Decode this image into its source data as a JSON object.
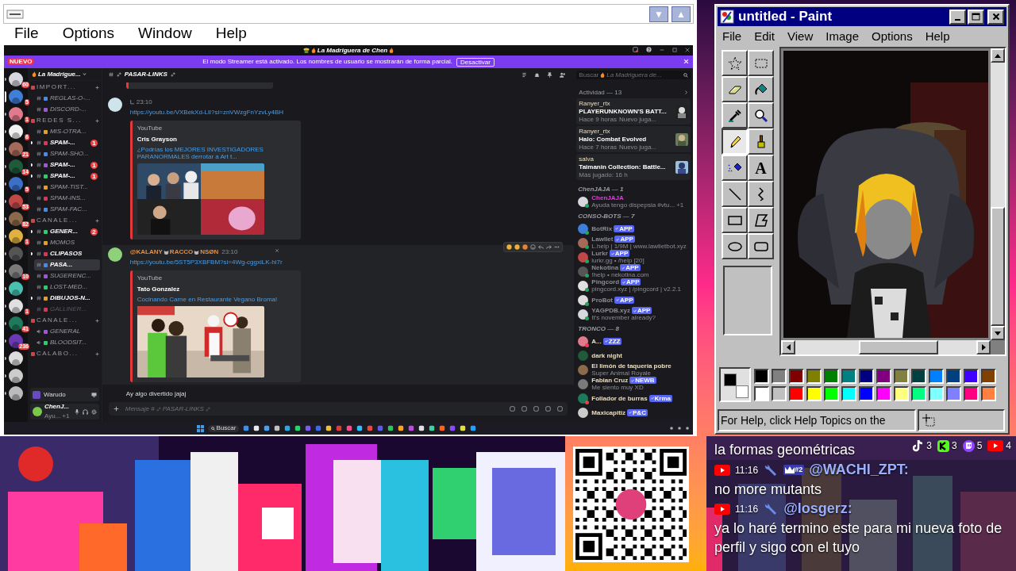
{
  "stream_window": {
    "menu": [
      "File",
      "Options",
      "Window",
      "Help"
    ],
    "title_buttons": [
      "▼",
      "▲"
    ]
  },
  "discord": {
    "title": "La Madriguera de Chen",
    "banner": {
      "new_badge": "NUEVO",
      "text": "El modo Streamer está activado. Los nombres de usuario se mostrarán de forma parcial.",
      "button": "Desactivar"
    },
    "servers": [
      {
        "badge": "60",
        "selected": false
      },
      {
        "badge": "5",
        "selected": true
      },
      {
        "badge": "1",
        "selected": false
      },
      {
        "badge": "6",
        "selected": false
      },
      {
        "badge": "21",
        "selected": false
      },
      {
        "badge": "14",
        "selected": false
      },
      {
        "badge": "5",
        "selected": false
      },
      {
        "badge": "53",
        "selected": false
      },
      {
        "badge": "82",
        "selected": false
      },
      {
        "badge": "1",
        "selected": false
      },
      {
        "selected": false
      },
      {
        "badge": "10",
        "selected": false
      },
      {
        "selected": false
      },
      {
        "badge": "1",
        "selected": false
      },
      {
        "badge": "41",
        "selected": false
      },
      {
        "badge": "236",
        "selected": false
      },
      {
        "selected": false
      },
      {
        "selected": false
      },
      {
        "selected": false
      }
    ],
    "server_name": "La Madrigue...",
    "channels": [
      {
        "kind": "category",
        "name": "IMPORT..."
      },
      {
        "kind": "text",
        "name": "REGLAS-O-...",
        "unread": false,
        "selected": false,
        "muted": false
      },
      {
        "kind": "text",
        "name": "DISCORD-...",
        "unread": false,
        "selected": false,
        "muted": false
      },
      {
        "kind": "category",
        "name": "REDES S..."
      },
      {
        "kind": "text",
        "name": "MIS-OTRA...",
        "unread": false,
        "selected": false,
        "muted": false
      },
      {
        "kind": "text",
        "name": "SPAM-...",
        "unread": true,
        "selected": false,
        "muted": false,
        "badge": "1"
      },
      {
        "kind": "text",
        "name": "SPAM-SHO...",
        "unread": false,
        "selected": false,
        "muted": false
      },
      {
        "kind": "text",
        "name": "SPAM-...",
        "unread": true,
        "selected": false,
        "muted": false,
        "badge": "1"
      },
      {
        "kind": "text",
        "name": "SPAM-...",
        "unread": true,
        "selected": false,
        "muted": false,
        "badge": "1"
      },
      {
        "kind": "text",
        "name": "SPAM-TIST...",
        "unread": false,
        "selected": false,
        "muted": false
      },
      {
        "kind": "text",
        "name": "SPAM-INS...",
        "unread": false,
        "selected": false,
        "muted": false
      },
      {
        "kind": "text",
        "name": "SPAM-FAC...",
        "unread": false,
        "selected": false,
        "muted": false
      },
      {
        "kind": "category",
        "name": "CANALE..."
      },
      {
        "kind": "text",
        "name": "GENER...",
        "unread": true,
        "selected": false,
        "muted": false,
        "badge": "2"
      },
      {
        "kind": "text",
        "name": "MOMOS",
        "unread": false,
        "selected": false,
        "muted": false
      },
      {
        "kind": "text",
        "name": "CLIPASOS",
        "unread": true,
        "selected": false,
        "muted": false
      },
      {
        "kind": "text",
        "name": "PASA...",
        "unread": false,
        "selected": true,
        "muted": false
      },
      {
        "kind": "text",
        "name": "SUGERENC...",
        "unread": false,
        "selected": false,
        "muted": false
      },
      {
        "kind": "text",
        "name": "LOST-MED...",
        "unread": false,
        "selected": false,
        "muted": false
      },
      {
        "kind": "text",
        "name": "DIBUJOS-N...",
        "unread": true,
        "selected": false,
        "muted": false
      },
      {
        "kind": "text",
        "name": "GALLINER...",
        "unread": false,
        "selected": false,
        "muted": true
      },
      {
        "kind": "category",
        "name": "CANALE..."
      },
      {
        "kind": "voice",
        "name": "GENERAL",
        "unread": false,
        "selected": false,
        "muted": false
      },
      {
        "kind": "voice",
        "name": "BLOODSIT...",
        "unread": false,
        "selected": false,
        "muted": false
      },
      {
        "kind": "category",
        "name": "CALABO..."
      }
    ],
    "warudo": "Warudo",
    "user": {
      "name": "ChenJ...",
      "status": "Ayu...",
      "extra": "+1"
    },
    "channel_title": "PASAR-LINKS",
    "messages": [
      {
        "kind": "embed",
        "time": "23:10",
        "link": "https://youtu.be/VXBekXd-LlI?si=znVWzgFnYzvLy4BH",
        "provider": "YouTube",
        "embed_author": "Cris Grayson",
        "embed_title": "¿Podrías los MEJORES INVESTIGADORES PARANORMALES derrotar a Art t...",
        "hovered": false
      },
      {
        "kind": "embed",
        "author_parts": [
          "@KALANY",
          "RACCO",
          "NSØN"
        ],
        "time": "23:10",
        "link": "https://youtu.be/5ST5P3XBFBM?si=4Wg-cggxiLK-hi7r",
        "provider": "YouTube",
        "embed_author": "Tato Gonzalez",
        "embed_title": "Cocinando Carne en Restaurante Vegano Broma!",
        "hovered": true
      },
      {
        "kind": "text",
        "text": "Ay algo divertido jajaj"
      }
    ],
    "message_input": {
      "placeholder": "Mensaje #",
      "channel": "PASAR-LINKS"
    },
    "search": {
      "placeholder": "Buscar",
      "server": "La Madriguera de..."
    },
    "activity_title": "Actividad — 13",
    "activities": [
      {
        "user": "Ranyer_rtx",
        "game": "PLAYERUNKNOWN'S BATT...",
        "time": "Hace 9 horas",
        "note": "Nuevo juga..."
      },
      {
        "user": "Ranyer_rtx",
        "game": "Halo: Combat Evolved",
        "time": "Hace 7 horas",
        "note": "Nuevo juga..."
      },
      {
        "user": "salva",
        "game": "Taimanin Collection: Battle...",
        "time": "Más jugado: 16 h"
      }
    ],
    "member_groups": [
      {
        "title": "ChenJAJA — 1",
        "members": [
          {
            "name": "ChenJAJA",
            "color": "#e23ce0",
            "status": {
              "color": "#23a55a"
            },
            "activity": "Ayuda tengo dispepsia #vtu...",
            "extra": "+1"
          }
        ]
      },
      {
        "title": "CONSO-BOTS — 7",
        "members": [
          {
            "name": "BotRix",
            "color": "#8a8d93",
            "status": {
              "color": "#23a55a"
            },
            "tag": "APP"
          },
          {
            "name": "Lawliet",
            "color": "#8a8d93",
            "status": {
              "color": "#23a55a"
            },
            "tag": "APP",
            "activity": "L.help | 1/9M | www.lawlietbot.xyz"
          },
          {
            "name": "Lurkr",
            "color": "#8a8d93",
            "status": {
              "color": "#23a55a"
            },
            "tag": "APP",
            "activity": "lurkr.gg • /help [20]"
          },
          {
            "name": "Nekotina",
            "color": "#8a8d93",
            "status": {
              "color": "#23a55a"
            },
            "tag": "APP",
            "activity": "!help • nekotina.com"
          },
          {
            "name": "Pingcord",
            "color": "#8a8d93",
            "status": {
              "color": "#23a55a"
            },
            "tag": "APP",
            "activity": "pingcord.xyz | /pingcord | v2.2.1"
          },
          {
            "name": "ProBot",
            "color": "#8a8d93",
            "status": {
              "color": "#23a55a"
            },
            "tag": "APP"
          },
          {
            "name": "YAGPDB.xyz",
            "color": "#8a8d93",
            "status": {
              "color": "#23a55a"
            },
            "tag": "APP",
            "activity": "It's november already?"
          }
        ]
      },
      {
        "title": "TRONCO — 8",
        "members": [
          {
            "name": "A...",
            "color": "#e9dcc0",
            "status": {
              "color": "#f23f43"
            },
            "tag": "ZZZ"
          },
          {
            "name": "dark night",
            "color": "#e9dcc0"
          },
          {
            "name": "El limón de taquería pobre",
            "color": "#e9dcc0",
            "activity": "Super Animal Royale"
          },
          {
            "name": "Fabian Cruz",
            "color": "#e9dcc0",
            "tag": "NEWB",
            "activity": "Me siento muy XD"
          },
          {
            "name": "Follador de burras",
            "color": "#e9dcc0",
            "status": {
              "color": "#f23f43"
            },
            "tag": "Krma"
          },
          {
            "name": "Maxicapitiz",
            "color": "#e9dcc0",
            "tag": "P&C"
          }
        ]
      }
    ],
    "taskbar": {
      "search": "Buscar"
    }
  },
  "paint": {
    "title": "untitled - Paint",
    "menu": [
      "File",
      "Edit",
      "View",
      "Image",
      "Options",
      "Help"
    ],
    "tools": [
      {
        "kind": "free-select",
        "selected": false
      },
      {
        "kind": "select",
        "selected": false
      },
      {
        "kind": "eraser",
        "selected": false
      },
      {
        "kind": "fill",
        "selected": false
      },
      {
        "kind": "picker",
        "selected": false
      },
      {
        "kind": "magnifier",
        "selected": false
      },
      {
        "kind": "pencil",
        "selected": true
      },
      {
        "kind": "brush",
        "selected": false
      },
      {
        "kind": "airbrush",
        "selected": false
      },
      {
        "kind": "text",
        "selected": false,
        "label": "A"
      },
      {
        "kind": "line",
        "selected": false
      },
      {
        "kind": "curve",
        "selected": false
      },
      {
        "kind": "rectangle",
        "selected": false
      },
      {
        "kind": "polygon",
        "selected": false
      },
      {
        "kind": "ellipse",
        "selected": false
      },
      {
        "kind": "rounded-rectangle",
        "selected": false
      }
    ],
    "current_colors": [
      {
        "color": "#000000"
      },
      {
        "color": "#ffffff"
      }
    ],
    "palette": [
      {
        "color": "#000000"
      },
      {
        "color": "#808080"
      },
      {
        "color": "#800000"
      },
      {
        "color": "#808000"
      },
      {
        "color": "#008000"
      },
      {
        "color": "#008080"
      },
      {
        "color": "#000080"
      },
      {
        "color": "#800080"
      },
      {
        "color": "#808040"
      },
      {
        "color": "#004040"
      },
      {
        "color": "#0080ff"
      },
      {
        "color": "#004080"
      },
      {
        "color": "#4000ff"
      },
      {
        "color": "#804000"
      },
      {
        "color": "#ffffff"
      },
      {
        "color": "#c0c0c0"
      },
      {
        "color": "#ff0000"
      },
      {
        "color": "#ffff00"
      },
      {
        "color": "#00ff00"
      },
      {
        "color": "#00ffff"
      },
      {
        "color": "#0000ff"
      },
      {
        "color": "#ff00ff"
      },
      {
        "color": "#ffff80"
      },
      {
        "color": "#00ff80"
      },
      {
        "color": "#80ffff"
      },
      {
        "color": "#8080ff"
      },
      {
        "color": "#ff0080"
      },
      {
        "color": "#ff8040"
      }
    ],
    "status": "For Help, click Help Topics on the"
  },
  "chat": {
    "counters": [
      {
        "kind": "tiktok",
        "count": "3"
      },
      {
        "kind": "kick",
        "count": "3"
      },
      {
        "kind": "twitch",
        "count": "5"
      },
      {
        "kind": "youtube",
        "count": "4"
      }
    ],
    "messages": [
      {
        "kind": "continuation",
        "text": "la formas geométricas"
      },
      {
        "kind": "youtube",
        "time": "11:16",
        "moderator": true,
        "rank": "#2",
        "user": "@WACHI_ZPT:",
        "text": "no more mutants"
      },
      {
        "kind": "youtube",
        "time": "11:16",
        "moderator": true,
        "user": "@losgerz:",
        "text": "ya lo haré termino este para mi nueva foto de perfil y sigo con el tuyo"
      }
    ]
  }
}
